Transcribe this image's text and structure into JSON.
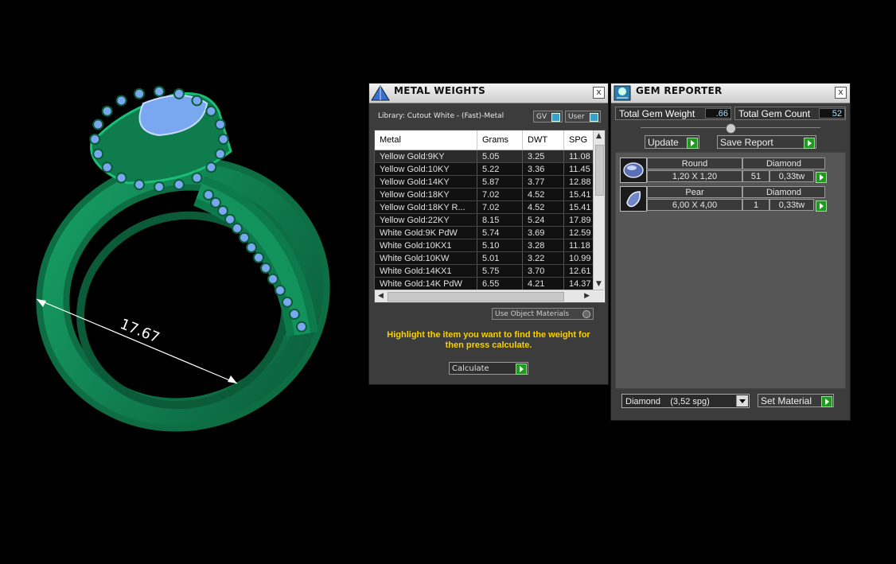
{
  "viewport": {
    "dimension_label": "17.67"
  },
  "metal_weights": {
    "title": "METAL WEIGHTS",
    "close": "x",
    "library": "Library: Cutout White - (Fast)-Metal",
    "toggle_gv": "GV",
    "toggle_user": "User",
    "columns": [
      "Metal",
      "Grams",
      "DWT",
      "SPG"
    ],
    "rows": [
      [
        "Yellow Gold:9KY",
        "5.05",
        "3.25",
        "11.08"
      ],
      [
        "Yellow Gold:10KY",
        "5.22",
        "3.36",
        "11.45"
      ],
      [
        "Yellow Gold:14KY",
        "5.87",
        "3.77",
        "12.88"
      ],
      [
        "Yellow Gold:18KY",
        "7.02",
        "4.52",
        "15.41"
      ],
      [
        "Yellow Gold:18KY R...",
        "7.02",
        "4.52",
        "15.41"
      ],
      [
        "Yellow Gold:22KY",
        "8.15",
        "5.24",
        "17.89"
      ],
      [
        "White Gold:9K PdW",
        "5.74",
        "3.69",
        "12.59"
      ],
      [
        "White Gold:10KX1",
        "5.10",
        "3.28",
        "11.18"
      ],
      [
        "White Gold:10KW",
        "5.01",
        "3.22",
        "10.99"
      ],
      [
        "White Gold:14KX1",
        "5.75",
        "3.70",
        "12.61"
      ],
      [
        "White Gold:14K PdW",
        "6.55",
        "4.21",
        "14.37"
      ]
    ],
    "use_object_materials": "Use Object Materials",
    "instruction": "Highlight the item you want to find the weight for then press calculate.",
    "calculate": "Calculate"
  },
  "gem_reporter": {
    "title": "GEM REPORTER",
    "close": "x",
    "total_weight_label": "Total Gem Weight",
    "total_weight_value": ".66",
    "total_count_label": "Total Gem Count",
    "total_count_value": "52",
    "update": "Update",
    "save_report": "Save Report",
    "gems": [
      {
        "shape": "Round",
        "material": "Diamond",
        "size": "1,20 X 1,20",
        "count": "51",
        "weight": "0,33tw"
      },
      {
        "shape": "Pear",
        "material": "Diamond",
        "size": "6,00 X 4,00",
        "count": "1",
        "weight": "0,33tw"
      }
    ],
    "material_select": "Diamond    (3,52 spg)",
    "set_material": "Set Material"
  },
  "colors": {
    "metal": "#0f8a55",
    "gem": "#7aa8f0",
    "instruction": "#f7d000"
  }
}
